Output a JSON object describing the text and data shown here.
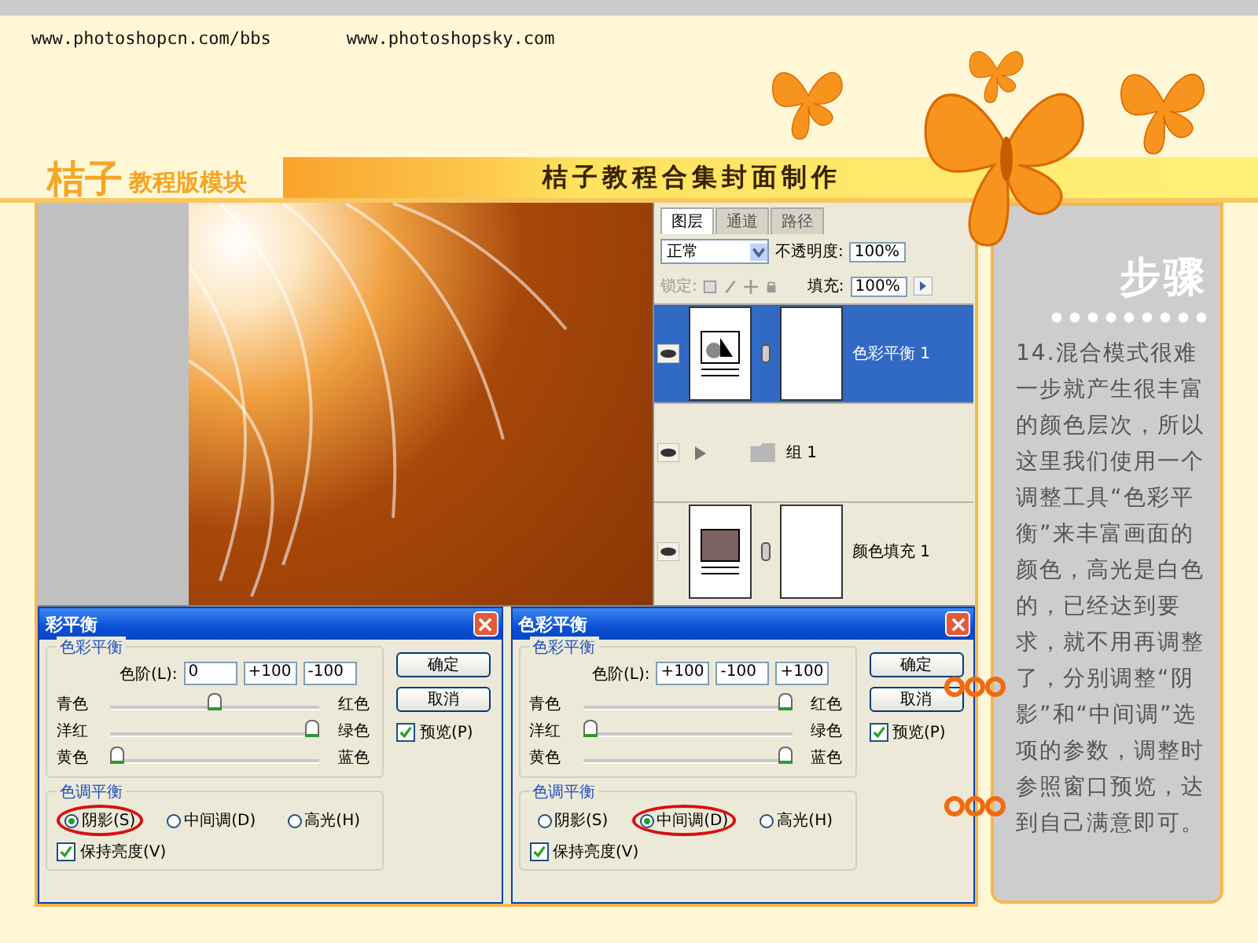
{
  "header": {
    "urls": [
      "www.photoshopcn.com/bbs",
      "www.photoshopsky.com"
    ],
    "logo": "桔子",
    "module": "教程版模块",
    "title": "桔子教程合集封面制作"
  },
  "layers_panel": {
    "tabs": [
      {
        "label": "图层",
        "selected": true
      },
      {
        "label": "通道",
        "selected": false
      },
      {
        "label": "路径",
        "selected": false
      }
    ],
    "blend_mode": "正常",
    "opacity_label": "不透明度:",
    "opacity": "100%",
    "lock_label": "锁定:",
    "fill_label": "填充:",
    "fill": "100%",
    "layers": [
      {
        "kind": "adjustment",
        "name": "色彩平衡 1",
        "selected": true
      },
      {
        "kind": "group",
        "name": "组 1",
        "selected": false
      },
      {
        "kind": "fill",
        "name": "颜色填充 1",
        "selected": false
      }
    ]
  },
  "dialogs": [
    {
      "title": "彩平衡",
      "section": "色彩平衡",
      "levels_label": "色阶(L):",
      "values": [
        "0",
        "+100",
        "-100"
      ],
      "sliders": [
        {
          "left": "青色",
          "right": "红色",
          "level": 0.5
        },
        {
          "left": "洋红",
          "right": "绿色",
          "level": 1
        },
        {
          "left": "黄色",
          "right": "蓝色",
          "level": 0
        }
      ],
      "ok": "确定",
      "cancel": "取消",
      "preview": {
        "label": "预览(P)",
        "checked": true
      },
      "tone_section": "色调平衡",
      "tones": [
        {
          "label": "阴影(S)",
          "selected": true
        },
        {
          "label": "中间调(D)",
          "selected": false
        },
        {
          "label": "高光(H)",
          "selected": false
        }
      ],
      "preserve": {
        "label": "保持亮度(V)",
        "checked": true
      }
    },
    {
      "title": "色彩平衡",
      "section": "色彩平衡",
      "levels_label": "色阶(L):",
      "values": [
        "+100",
        "-100",
        "+100"
      ],
      "sliders": [
        {
          "left": "青色",
          "right": "红色",
          "level": 1
        },
        {
          "left": "洋红",
          "right": "绿色",
          "level": 0
        },
        {
          "left": "黄色",
          "right": "蓝色",
          "level": 1
        }
      ],
      "ok": "确定",
      "cancel": "取消",
      "preview": {
        "label": "预览(P)",
        "checked": true
      },
      "tone_section": "色调平衡",
      "tones": [
        {
          "label": "阴影(S)",
          "selected": false
        },
        {
          "label": "中间调(D)",
          "selected": true
        },
        {
          "label": "高光(H)",
          "selected": false
        }
      ],
      "preserve": {
        "label": "保持亮度(V)",
        "checked": true
      }
    }
  ],
  "step": {
    "title": "步骤",
    "text": "14.混合模式很难一步就产生很丰富的颜色层次，所以这里我们使用一个调整工具“色彩平衡”来丰富画面的颜色，高光是白色的，已经达到要求，就不用再调整了，分别调整“阴影”和“中间调”选项的参数，调整时参照窗口预览，达到自己满意即可。"
  }
}
